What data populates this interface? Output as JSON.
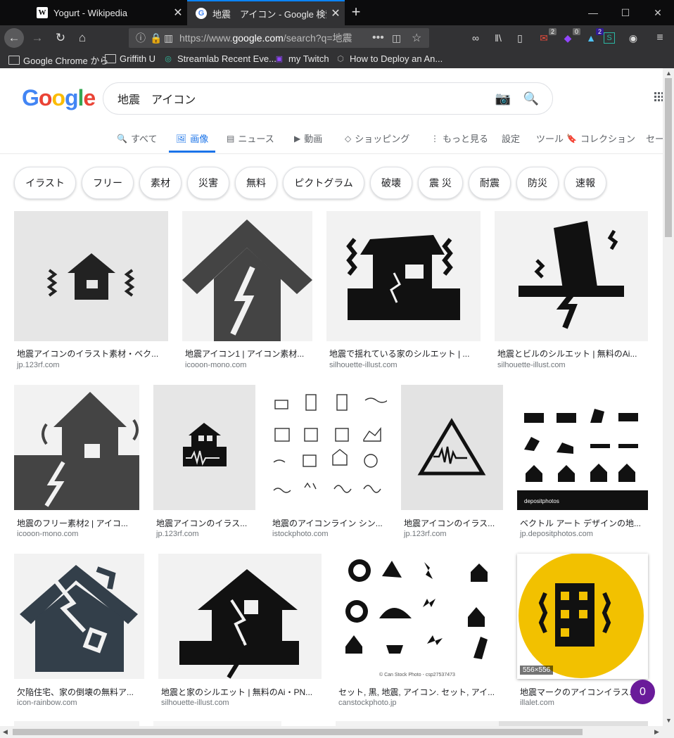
{
  "browser": {
    "tabs": [
      {
        "favicon": "W",
        "title": "Yogurt - Wikipedia"
      },
      {
        "favicon": "G",
        "title": "地震　アイコン - Google 検索"
      }
    ],
    "url_prefix": "https://www.",
    "url_domain": "google.com",
    "url_rest": "/search?q=地震",
    "toolbar_badges": {
      "mail": "2",
      "ext1": "0",
      "ext2": "2"
    },
    "bookmarks": [
      "Google Chrome から",
      "Griffith U",
      "Streamlab Recent Eve...",
      "my Twitch",
      "How to Deploy an An..."
    ]
  },
  "google": {
    "logo_letters": [
      {
        "ch": "G",
        "color": "#4285F4"
      },
      {
        "ch": "o",
        "color": "#EA4335"
      },
      {
        "ch": "o",
        "color": "#FBBC05"
      },
      {
        "ch": "g",
        "color": "#4285F4"
      },
      {
        "ch": "l",
        "color": "#34A853"
      },
      {
        "ch": "e",
        "color": "#EA4335"
      }
    ],
    "query": "地震　アイコン",
    "nav": [
      {
        "icon": "🔍",
        "label": "すべて"
      },
      {
        "icon": "🖼",
        "label": "画像"
      },
      {
        "icon": "▤",
        "label": "ニュース"
      },
      {
        "icon": "▶",
        "label": "動画"
      },
      {
        "icon": "◇",
        "label": "ショッピング"
      },
      {
        "icon": "⋮",
        "label": "もっと見る"
      },
      {
        "icon": "",
        "label": "設定"
      },
      {
        "icon": "",
        "label": "ツール"
      },
      {
        "icon": "🔖",
        "label": "コレクション"
      },
      {
        "icon": "",
        "label": "セー"
      }
    ],
    "chips": [
      "イラスト",
      "フリー",
      "素材",
      "災害",
      "無料",
      "ピクトグラム",
      "破壊",
      "震 災",
      "耐震",
      "防災",
      "速報"
    ],
    "results": [
      {
        "title": "地震アイコンのイラスト素材・ベク...",
        "source": "jp.123rf.com",
        "icon": "house-shaking-icon"
      },
      {
        "title": "地震アイコン1 | アイコン素材...",
        "source": "icooon-mono.com",
        "icon": "cracked-house-icon"
      },
      {
        "title": "地震で揺れている家のシルエット | ...",
        "source": "silhouette-illust.com",
        "icon": "shaking-house-silhouette-icon"
      },
      {
        "title": "地震とビルのシルエット | 無料のAi...",
        "source": "silhouette-illust.com",
        "icon": "building-quake-icon"
      },
      {
        "title": "地震のフリー素材2 | アイコ...",
        "source": "icooon-mono.com",
        "icon": "house-crack-icon"
      },
      {
        "title": "地震アイコンのイラス...",
        "source": "jp.123rf.com",
        "icon": "seismic-house-icon"
      },
      {
        "title": "地震のアイコンライン シン...",
        "source": "istockphoto.com",
        "icon": "line-icons-grid"
      },
      {
        "title": "地震アイコンのイラス...",
        "source": "jp.123rf.com",
        "icon": "warning-triangle-icon"
      },
      {
        "title": "ベクトル アート デザインの地...",
        "source": "jp.depositphotos.com",
        "icon": "disaster-icons-grid"
      },
      {
        "title": "欠陥住宅、家の倒壊の無料ア...",
        "source": "icon-rainbow.com",
        "icon": "collapsed-house-icon"
      },
      {
        "title": "地震と家のシルエット | 無料のAi・PN...",
        "source": "silhouette-illust.com",
        "icon": "house-split-icon"
      },
      {
        "title": "セット, 黒, 地震, アイコン. セット, アイ...",
        "source": "canstockphoto.jp",
        "icon": "canstock-icons-grid"
      },
      {
        "title": "地震マークのアイコンイラス...",
        "source": "illalet.com",
        "icon": "yellow-building-icon"
      }
    ],
    "dimension_label": "556×556",
    "canstock_text": "© Can Stock Photo - csp27537473",
    "fab_count": "0"
  }
}
